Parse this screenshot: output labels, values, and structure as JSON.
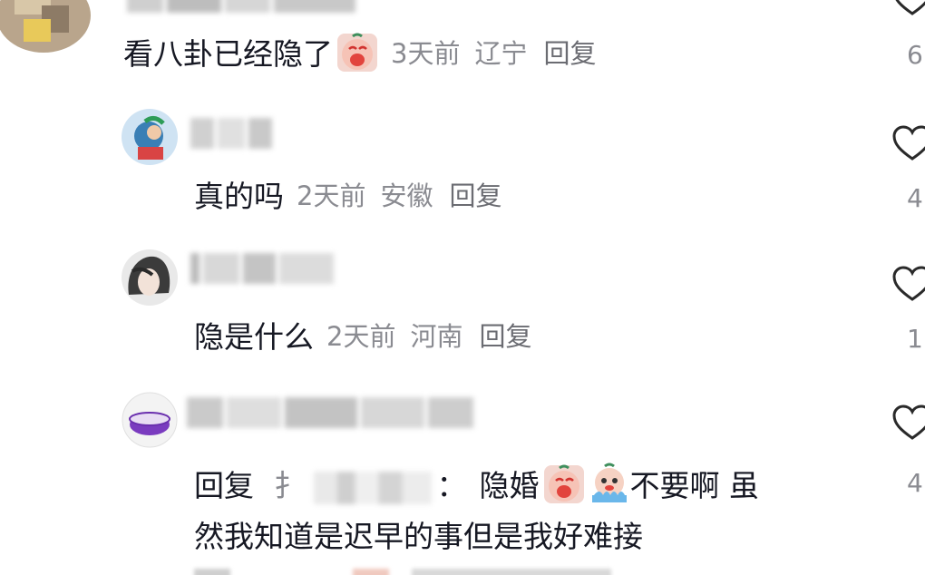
{
  "comments": [
    {
      "text": "看八卦已经隐了",
      "time": "3天前",
      "location": "辽宁",
      "reply_label": "回复",
      "like_count": "6",
      "emoji": [
        "crying-face-emoji"
      ]
    },
    {
      "text": "真的吗",
      "time": "2天前",
      "location": "安徽",
      "reply_label": "回复",
      "like_count": "4"
    },
    {
      "text": "隐是什么",
      "time": "2天前",
      "location": "河南",
      "reply_label": "回复",
      "like_count": "1"
    },
    {
      "reply_prefix": "回复",
      "reply_target_initial": "扌",
      "colon": "：",
      "text_a": "隐婚",
      "text_b": "不要啊 虽",
      "line2": "然我知道是迟早的事但是我好难接",
      "emoji": [
        "crying-face-emoji",
        "sobbing-face-emoji"
      ],
      "like_count": "4"
    }
  ],
  "colors": {
    "primary_text": "#161823",
    "meta_text": "#8a8b91",
    "icon_stroke": "#2a2a2a"
  }
}
